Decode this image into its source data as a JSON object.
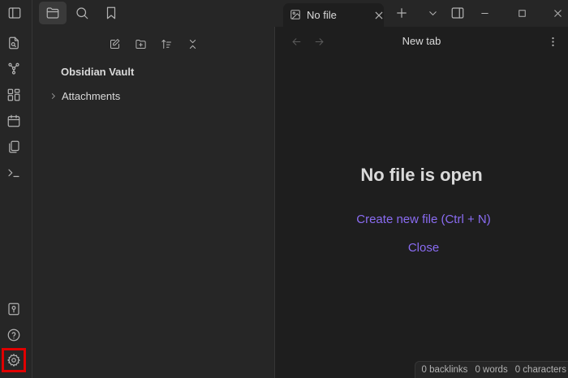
{
  "tab": {
    "label": "No file"
  },
  "nav": {
    "title": "New tab"
  },
  "vault": {
    "name": "Obsidian Vault"
  },
  "folders": [
    {
      "label": "Attachments"
    }
  ],
  "empty_state": {
    "title": "No file is open",
    "create_link": "Create new file (Ctrl + N)",
    "close_link": "Close"
  },
  "status_bar": {
    "backlinks": "0 backlinks",
    "words": "0 words",
    "characters": "0 characters"
  },
  "colors": {
    "accent": "#8a6cf2",
    "highlight": "#e00000"
  }
}
